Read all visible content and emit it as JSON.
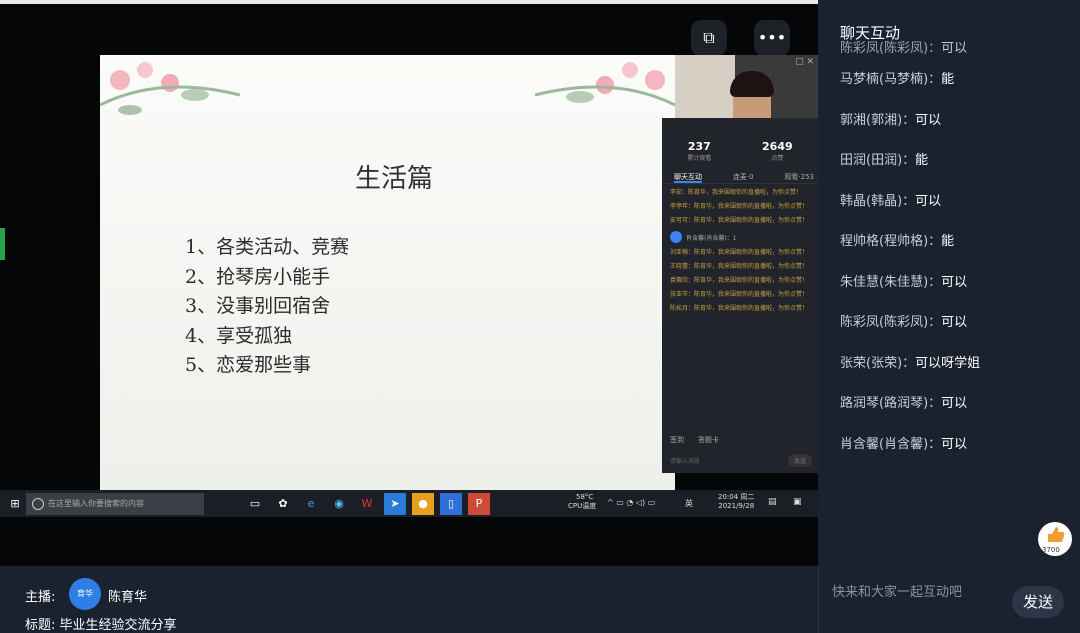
{
  "slide": {
    "title": "生活篇",
    "items": [
      "1、各类活动、竞赛",
      "2、抢琴房小能手",
      "3、没事别回宿舍",
      "4、享受孤独",
      "5、恋爱那些事"
    ]
  },
  "top_icons": {
    "rotate": "⧉",
    "more": "•••"
  },
  "mini_panel": {
    "stat1_value": "237",
    "stat1_label": "累计观看",
    "stat2_value": "2649",
    "stat2_label": "点赞",
    "tabs": [
      "聊天互动",
      "连麦·0",
      "观看·253"
    ],
    "messages": [
      "李茹：陈育华，我来围观你的直播啦，为你点赞！",
      "李停年：陈育华，我来围观你的直播啦，为你点赞！",
      "安可可：陈育华，我来围观你的直播啦，为你点赞！",
      "刘亚楠：陈育华，我来围观你的直播啦，为你点赞！",
      "王晓蕾：陈育华，我来围观你的直播啦，为你点赞！",
      "袁赛欣：陈育华，我来围观你的直播啦，为你点赞！",
      "张亚岑：陈育华，我来围观你的直播啦，为你点赞！",
      "陈松月：陈育华，我来围观你的直播啦，为你点赞！"
    ],
    "gift_line": "肖含馨(肖含馨)：1",
    "foot_left": "签到",
    "foot_right": "答题卡",
    "input_placeholder": "请输入消息",
    "send": "发送"
  },
  "taskbar": {
    "search_placeholder": "在这里输入你要搜索的内容",
    "temp": "58°C",
    "cpu": "CPU温度",
    "lang": "英",
    "time": "20:04 周二",
    "date": "2021/9/28"
  },
  "chat": {
    "header": "聊天互动",
    "messages": [
      {
        "name": "陈彩凤(陈彩凤)：",
        "text": "可以"
      },
      {
        "name": "马梦楠(马梦楠)：",
        "text": "能"
      },
      {
        "name": "郭湘(郭湘)：",
        "text": "可以"
      },
      {
        "name": "田润(田润)：",
        "text": "能"
      },
      {
        "name": "韩晶(韩晶)：",
        "text": "可以"
      },
      {
        "name": "程帅格(程帅格)：",
        "text": "能"
      },
      {
        "name": "朱佳慧(朱佳慧)：",
        "text": "可以"
      },
      {
        "name": "陈彩凤(陈彩凤)：",
        "text": "可以"
      },
      {
        "name": "张荣(张荣)：",
        "text": "可以呀学姐"
      },
      {
        "name": "路润琴(路润琴)：",
        "text": "可以"
      },
      {
        "name": "肖含馨(肖含馨)：",
        "text": "可以"
      }
    ],
    "like_count": "3700",
    "input_placeholder": "快来和大家一起互动吧",
    "send": "发送"
  },
  "host": {
    "label": "主播:",
    "avatar_text": "育华",
    "name": "陈育华"
  },
  "title": {
    "label": "标题:",
    "value": "毕业生经验交流分享"
  },
  "colors": {
    "accent": "#2f7ee6",
    "panel": "#1a2230"
  }
}
